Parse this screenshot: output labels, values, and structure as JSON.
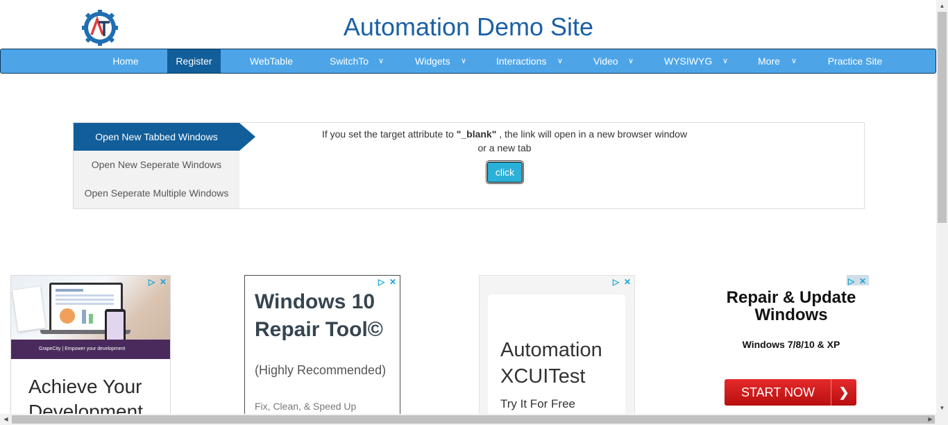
{
  "header": {
    "title": "Automation Demo Site",
    "logo_letters": "AT"
  },
  "nav": {
    "items": [
      {
        "label": "Home"
      },
      {
        "label": "Register"
      },
      {
        "label": "WebTable"
      },
      {
        "label": "SwitchTo"
      },
      {
        "label": "Widgets"
      },
      {
        "label": "Interactions"
      },
      {
        "label": "Video"
      },
      {
        "label": "WYSIWYG"
      },
      {
        "label": "More"
      },
      {
        "label": "Practice Site"
      }
    ],
    "active": "Register",
    "dropdown_icon": "chevron-down-icon"
  },
  "tabs": {
    "items": [
      {
        "label": "Open New Tabbed Windows"
      },
      {
        "label": "Open New Seperate Windows"
      },
      {
        "label": "Open Seperate Multiple Windows"
      }
    ],
    "active": "Open New Tabbed Windows"
  },
  "content": {
    "text_before": "If you set the target attribute to ",
    "text_code": "\"_blank\"",
    "text_after": " , the link will open in a new browser window",
    "text_line2": "or a new tab",
    "button_label": "click"
  },
  "ads": [
    {
      "strip_text": "GrapeCity | Empower your development",
      "headline": "Achieve Your Development"
    },
    {
      "headline": "Windows 10 Repair Tool©",
      "sub": "(Highly Recommended)",
      "sub2": "Fix, Clean, & Speed Up"
    },
    {
      "headline": "Automation XCUITest",
      "sub": "Try It For Free"
    },
    {
      "headline": "Repair & Update Windows",
      "sub": "Windows 7/8/10 & XP",
      "button": "START NOW"
    }
  ],
  "colors": {
    "title": "#1b60a5",
    "navbar": "#4da5e8",
    "active": "#115e9a",
    "button": "#2bb0d8",
    "ad_button": "#d41c1c"
  }
}
